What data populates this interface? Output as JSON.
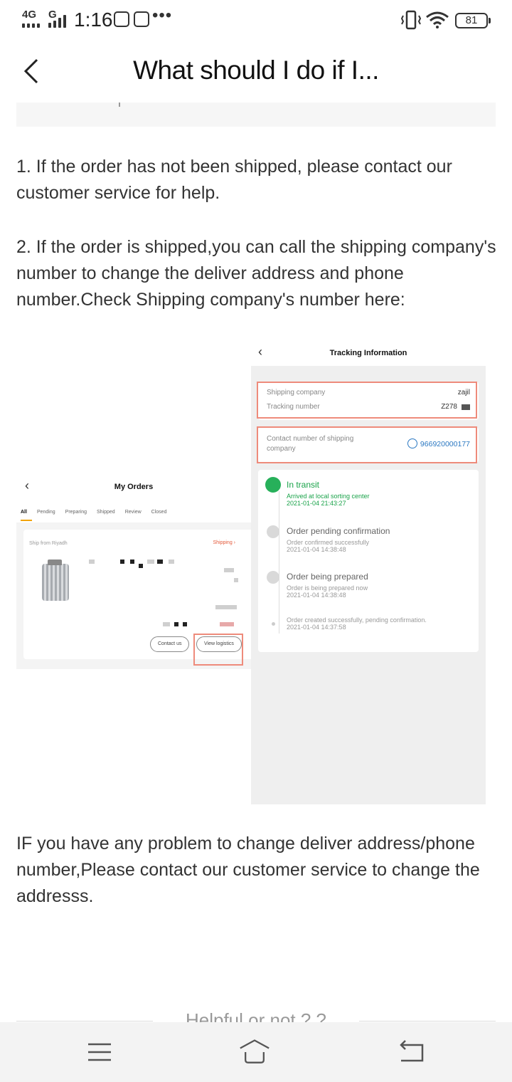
{
  "status_bar": {
    "network_a": "4G",
    "network_b": "G",
    "time": "1:16",
    "battery": "81"
  },
  "header": {
    "title": "What should I do if I..."
  },
  "article": {
    "paragraph_1": "1. If the order has not been shipped, please contact our customer service for help.",
    "paragraph_2": "2. If the order is shipped,you can call the shipping company's number to change the deliver address and phone number.Check Shipping company's number here:",
    "paragraph_3": "IF you have any problem to change deliver address/phone number,Please contact our customer service to change the addresss."
  },
  "screenshot_my_orders": {
    "title": "My Orders",
    "tabs": [
      "All",
      "Pending",
      "Preparing",
      "Shipped",
      "Review",
      "Closed"
    ],
    "ship_from": "Ship from Riyadh",
    "status": "Shipping",
    "contact_button": "Contact us",
    "logistics_button": "View logistics"
  },
  "screenshot_tracking": {
    "title": "Tracking Information",
    "shipping_company_label": "Shipping company",
    "shipping_company_value": "zajil",
    "tracking_number_label": "Tracking number",
    "tracking_number_value": "Z278",
    "contact_label": "Contact number of shipping company",
    "contact_number": "966920000177",
    "timeline": [
      {
        "title": "In transit",
        "detail": "Arrived at local sorting center",
        "time": "2021-01-04 21:43:27"
      },
      {
        "title": "Order pending confirmation",
        "detail": "Order confirmed successfully",
        "time": "2021-01-04 14:38:48"
      },
      {
        "title": "Order being prepared",
        "detail": "Order is being prepared now",
        "time": "2021-01-04 14:38:48"
      },
      {
        "title": "",
        "detail": "Order created successfully, pending confirmation.",
        "time": "2021-01-04 14:37:58"
      }
    ]
  },
  "footer": {
    "helpful_text": "Helpful or not ? ?"
  },
  "icons": {
    "back": "chevron-left-icon",
    "menu": "menu-icon",
    "home": "home-icon",
    "return": "return-icon"
  },
  "colors": {
    "highlight": "#ee8b7b",
    "transit_green": "#1aa34a",
    "phone_blue": "#2b78c2",
    "shipping_red": "#e45a3b"
  }
}
